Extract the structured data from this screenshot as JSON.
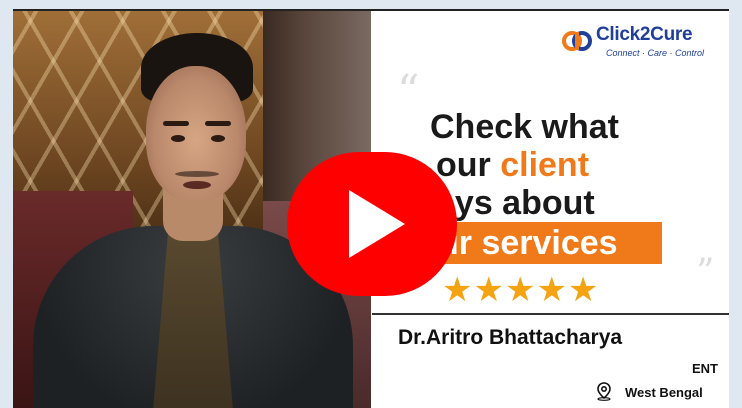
{
  "video": {
    "play_label": "Play video"
  },
  "brand": {
    "name": "Click2Cure",
    "tagline": "Connect · Care · Control",
    "primary_color": "#1f3f9a",
    "accent_color": "#f07a1a"
  },
  "headline": {
    "line1": "Check what",
    "line2_prefix": "our ",
    "line2_highlight": "client",
    "line3": "ays about",
    "line4": "ur services"
  },
  "rating": {
    "stars": "★★★★★",
    "value": 5
  },
  "doctor": {
    "name": "Dr.Aritro Bhattacharya",
    "specialty": "ENT",
    "location": "West Bengal"
  },
  "icons": {
    "play": "play-icon",
    "location": "location-pin-icon",
    "logo": "click2cure-logo-icon"
  }
}
